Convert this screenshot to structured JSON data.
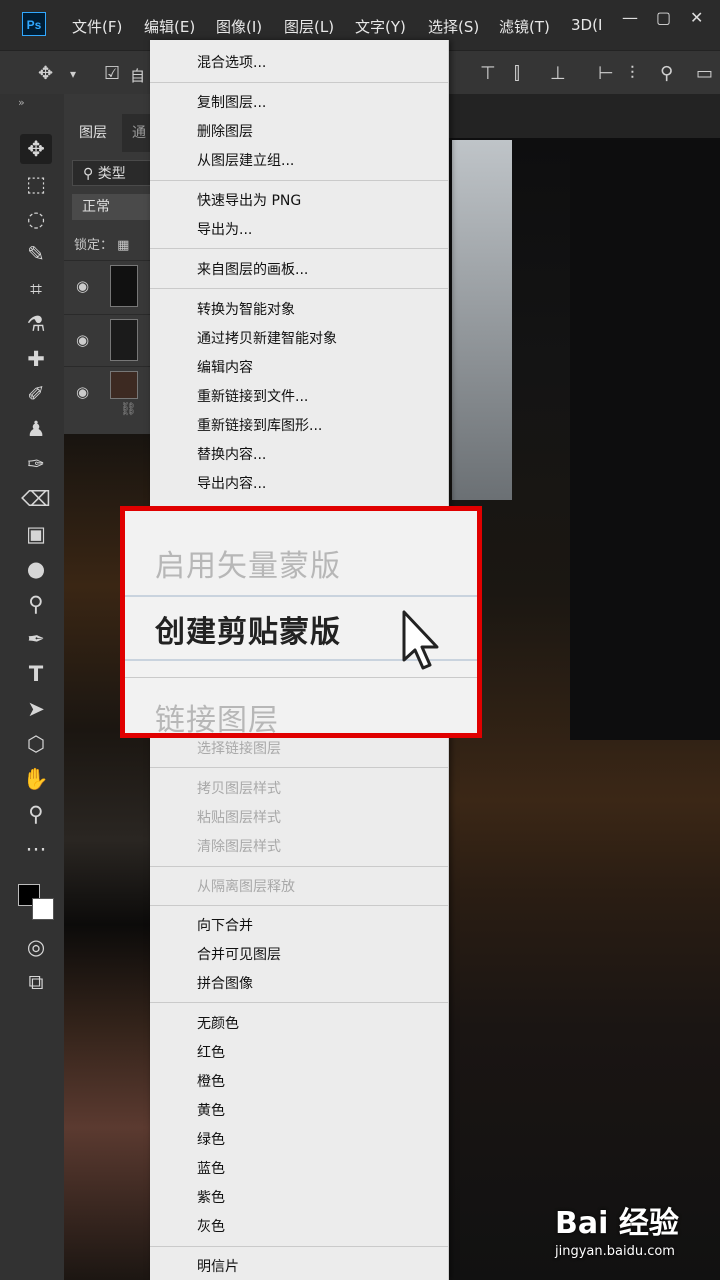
{
  "app": {
    "logo_text": "Ps"
  },
  "menubar": {
    "items": [
      "文件(F)",
      "编辑(E)",
      "图像(I)",
      "图层(L)",
      "文字(Y)",
      "选择(S)",
      "滤镜(T)",
      "3D(I"
    ],
    "window_controls": [
      "—",
      "▢",
      "✕"
    ]
  },
  "options_bar": {
    "auto_select_label": "自"
  },
  "layers_panel": {
    "tab_label": "图层",
    "tab2_label": "通",
    "filter_label": "类型",
    "blend_mode": "正常",
    "lock_label": "锁定："
  },
  "context_menu": {
    "items": [
      {
        "label": "混合选项...",
        "disabled": false
      },
      {
        "label": "复制图层...",
        "disabled": false
      },
      {
        "label": "删除图层",
        "disabled": false
      },
      {
        "label": "从图层建立组...",
        "disabled": false
      },
      {
        "label": "快速导出为 PNG",
        "disabled": false
      },
      {
        "label": "导出为...",
        "disabled": false
      },
      {
        "label": "来自图层的画板...",
        "disabled": false
      },
      {
        "label": "转换为智能对象",
        "disabled": false
      },
      {
        "label": "通过拷贝新建智能对象",
        "disabled": false
      },
      {
        "label": "编辑内容",
        "disabled": false
      },
      {
        "label": "重新链接到文件...",
        "disabled": false
      },
      {
        "label": "重新链接到库图形...",
        "disabled": false
      },
      {
        "label": "替换内容...",
        "disabled": false
      },
      {
        "label": "导出内容...",
        "disabled": false
      },
      {
        "label": "选择链接图层",
        "disabled": true
      },
      {
        "label": "拷贝图层样式",
        "disabled": true
      },
      {
        "label": "粘贴图层样式",
        "disabled": true
      },
      {
        "label": "清除图层样式",
        "disabled": true
      },
      {
        "label": "从隔离图层释放",
        "disabled": true
      },
      {
        "label": "向下合并",
        "disabled": false
      },
      {
        "label": "合并可见图层",
        "disabled": false
      },
      {
        "label": "拼合图像",
        "disabled": false
      },
      {
        "label": "无颜色",
        "disabled": false
      },
      {
        "label": "红色",
        "disabled": false
      },
      {
        "label": "橙色",
        "disabled": false
      },
      {
        "label": "黄色",
        "disabled": false
      },
      {
        "label": "绿色",
        "disabled": false
      },
      {
        "label": "蓝色",
        "disabled": false
      },
      {
        "label": "紫色",
        "disabled": false
      },
      {
        "label": "灰色",
        "disabled": false
      },
      {
        "label": "明信片",
        "disabled": false
      }
    ]
  },
  "zoom_callout": {
    "items": [
      {
        "label": "启用矢量蒙版",
        "disabled": true
      },
      {
        "label": "创建剪贴蒙版",
        "disabled": false,
        "highlighted": true
      },
      {
        "label": "链接图层",
        "disabled": true
      }
    ],
    "border_color": "#e00000"
  },
  "watermark": {
    "main": "Bai 经验",
    "sub": "jingyan.baidu.com"
  }
}
